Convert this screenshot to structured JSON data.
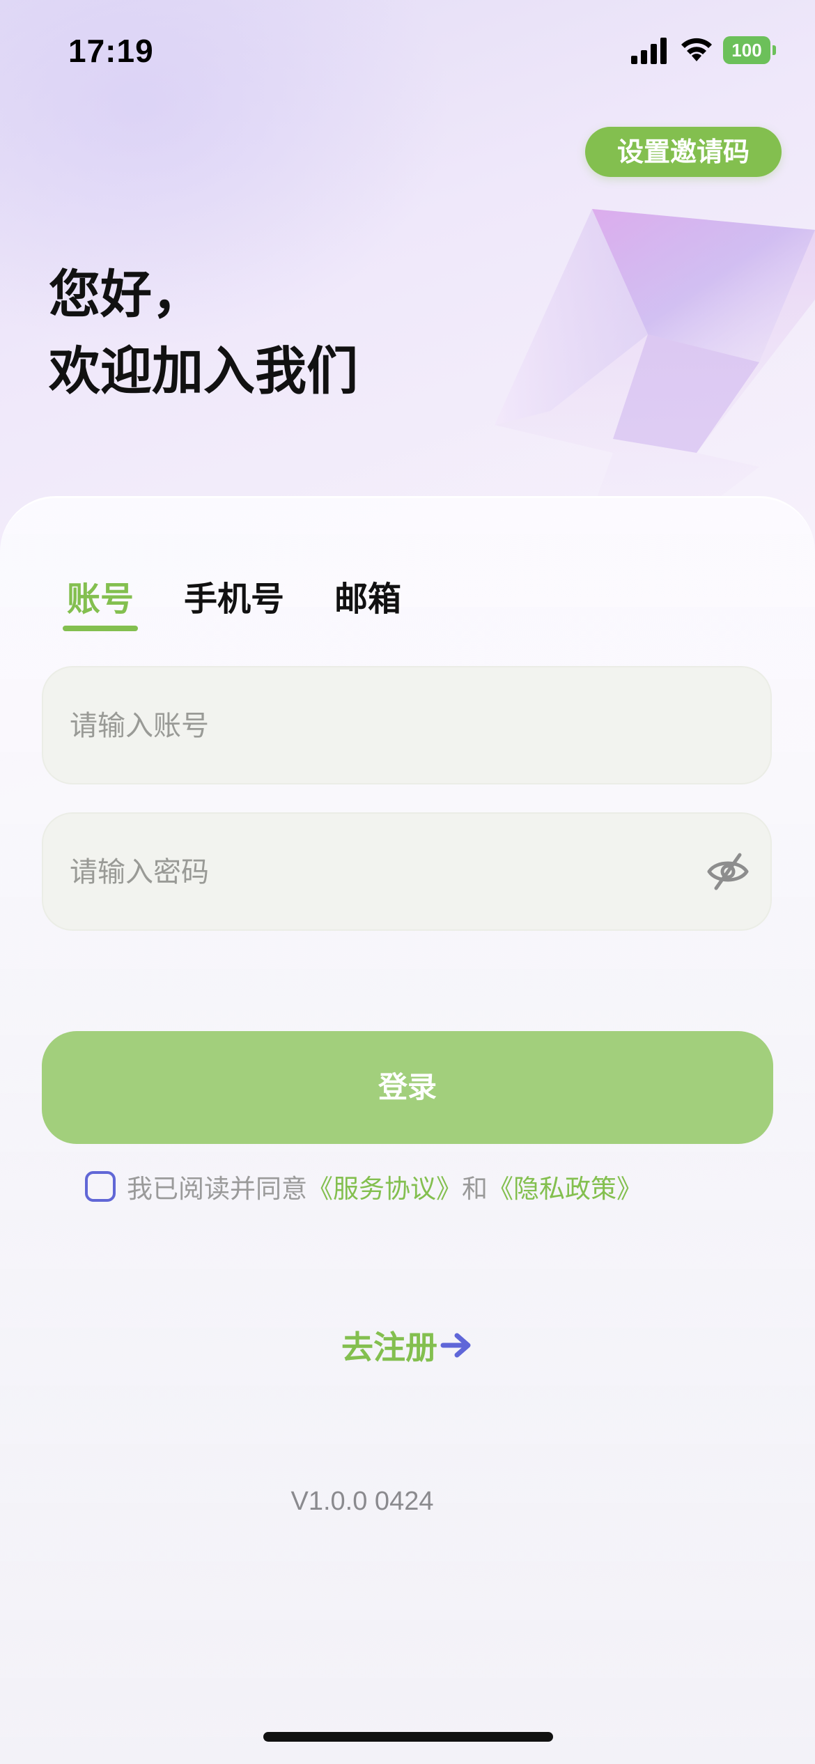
{
  "status_bar": {
    "time": "17:19",
    "battery": "100",
    "signal_icon": "cellular-signal-icon",
    "wifi_icon": "wifi-icon",
    "battery_color": "#6cc05a"
  },
  "invite_button": {
    "label": "设置邀请码"
  },
  "greeting": {
    "line1": "您好，",
    "line2": "欢迎加入我们"
  },
  "tabs": [
    {
      "label": "账号",
      "active": true
    },
    {
      "label": "手机号",
      "active": false
    },
    {
      "label": "邮箱",
      "active": false
    }
  ],
  "account_field": {
    "placeholder": "请输入账号",
    "value": ""
  },
  "password_field": {
    "placeholder": "请输入密码",
    "value": "",
    "toggle_icon": "eye-slash-icon"
  },
  "login_button": {
    "label": "登录"
  },
  "agreement": {
    "checked": false,
    "prefix": "我已阅读并同意",
    "service_link": "《服务协议》",
    "conjunction": "和",
    "privacy_link": "《隐私政策》"
  },
  "register": {
    "label": "去注册",
    "icon": "arrow-right-icon"
  },
  "version": "V1.0.0 0424",
  "colors": {
    "accent": "#83bf4f",
    "login_button": "#a2cf7c",
    "checkbox_border": "#6167d6",
    "arrow": "#5f66d8"
  }
}
